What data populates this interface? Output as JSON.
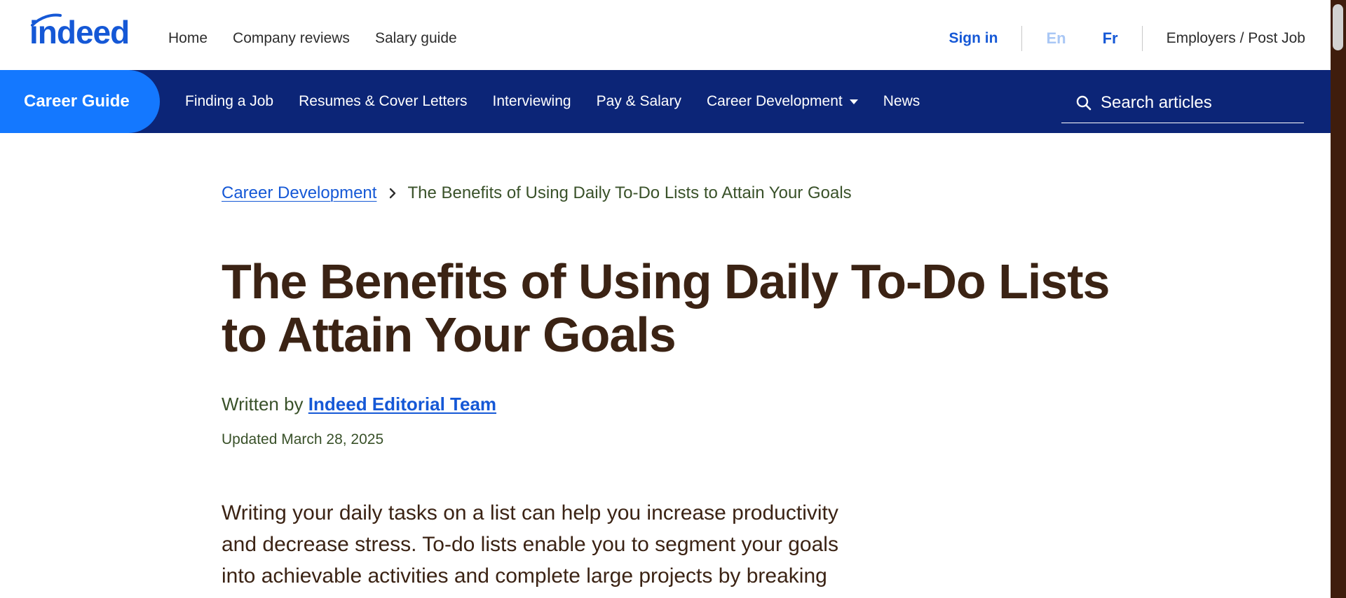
{
  "header": {
    "logo_text": "indeed",
    "nav": [
      "Home",
      "Company reviews",
      "Salary guide"
    ],
    "sign_in": "Sign in",
    "lang_en": "En",
    "lang_fr": "Fr",
    "employers": "Employers / Post Job"
  },
  "career_nav": {
    "tab": "Career Guide",
    "items": [
      "Finding a Job",
      "Resumes & Cover Letters",
      "Interviewing",
      "Pay & Salary",
      "Career Development",
      "News"
    ],
    "search_placeholder": "Search articles"
  },
  "article": {
    "breadcrumb_parent": "Career Development",
    "breadcrumb_current": "The Benefits of Using Daily To-Do Lists to Attain Your Goals",
    "title": "The Benefits of Using Daily To-Do Lists to Attain Your Goals",
    "written_by": "Written by",
    "author": "Indeed Editorial Team",
    "updated": "Updated March 28, 2025",
    "intro": "Writing your daily tasks on a list can help you increase productivity and decrease stress. To-do lists enable you to segment your goals into achievable activities and complete large projects by breaking"
  },
  "colors": {
    "brand_blue": "#1558d6",
    "nav_navy": "#0c2577",
    "tab_blue": "#1478ff",
    "title_brown": "#3b2314",
    "meta_green": "#395129"
  }
}
